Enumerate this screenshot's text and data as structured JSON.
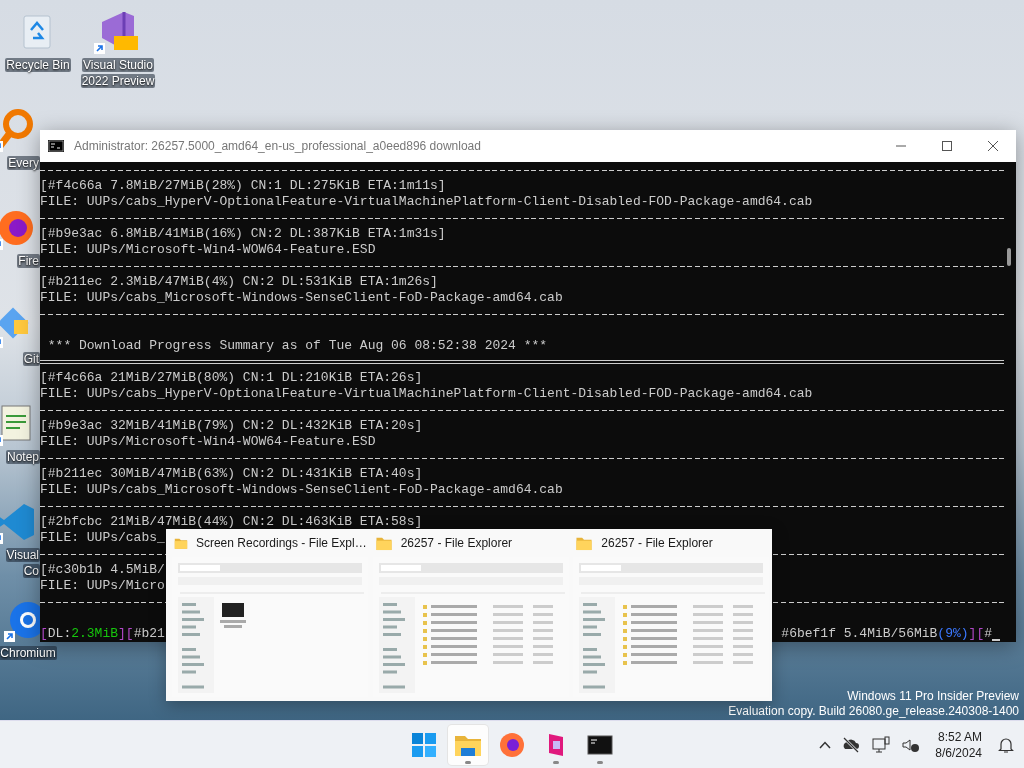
{
  "desktop_icons": [
    {
      "kind": "recycle",
      "shortcut": false,
      "label_lines": [
        "Recycle Bin"
      ]
    },
    {
      "kind": "vs",
      "shortcut": true,
      "label_lines": [
        "Visual Studio",
        "2022 Preview"
      ]
    },
    {
      "kind": "search",
      "shortcut": true,
      "label_lines": [
        "Every"
      ]
    },
    {
      "kind": "firefox",
      "shortcut": true,
      "label_lines": [
        "Fire"
      ]
    },
    {
      "kind": "git",
      "shortcut": true,
      "label_lines": [
        "Git"
      ]
    },
    {
      "kind": "notepad",
      "shortcut": true,
      "label_lines": [
        "Notep"
      ]
    },
    {
      "kind": "vscode",
      "shortcut": true,
      "label_lines": [
        "Visual",
        "Co"
      ]
    },
    {
      "kind": "chromium",
      "shortcut": true,
      "label_lines": [
        "Chromium"
      ]
    }
  ],
  "terminal": {
    "title": "Administrator:  26257.5000_amd64_en-us_professional_a0eed896 download",
    "lines": [
      {
        "kind": "rule"
      },
      {
        "kind": "text",
        "text": "[#f4c66a 7.8MiB/27MiB(28%) CN:1 DL:275KiB ETA:1m11s]"
      },
      {
        "kind": "text",
        "text": "FILE: UUPs/cabs_HyperV-OptionalFeature-VirtualMachinePlatform-Client-Disabled-FOD-Package-amd64.cab"
      },
      {
        "kind": "rule"
      },
      {
        "kind": "text",
        "text": "[#b9e3ac 6.8MiB/41MiB(16%) CN:2 DL:387KiB ETA:1m31s]"
      },
      {
        "kind": "text",
        "text": "FILE: UUPs/Microsoft-Win4-WOW64-Feature.ESD"
      },
      {
        "kind": "rule"
      },
      {
        "kind": "text",
        "text": "[#b211ec 2.3MiB/47MiB(4%) CN:2 DL:531KiB ETA:1m26s]"
      },
      {
        "kind": "text",
        "text": "FILE: UUPs/cabs_Microsoft-Windows-SenseClient-FoD-Package-amd64.cab"
      },
      {
        "kind": "rule"
      },
      {
        "kind": "blank"
      },
      {
        "kind": "text",
        "text": " *** Download Progress Summary as of Tue Aug 06 08:52:38 2024 ***"
      },
      {
        "kind": "double-rule"
      },
      {
        "kind": "text",
        "text": "[#f4c66a 21MiB/27MiB(80%) CN:1 DL:210KiB ETA:26s]"
      },
      {
        "kind": "text",
        "text": "FILE: UUPs/cabs_HyperV-OptionalFeature-VirtualMachinePlatform-Client-Disabled-FOD-Package-amd64.cab"
      },
      {
        "kind": "rule"
      },
      {
        "kind": "text",
        "text": "[#b9e3ac 32MiB/41MiB(79%) CN:2 DL:432KiB ETA:20s]"
      },
      {
        "kind": "text",
        "text": "FILE: UUPs/Microsoft-Win4-WOW64-Feature.ESD"
      },
      {
        "kind": "rule"
      },
      {
        "kind": "text",
        "text": "[#b211ec 30MiB/47MiB(63%) CN:2 DL:431KiB ETA:40s]"
      },
      {
        "kind": "text",
        "text": "FILE: UUPs/cabs_Microsoft-Windows-SenseClient-FoD-Package-amd64.cab"
      },
      {
        "kind": "rule"
      },
      {
        "kind": "text",
        "text": "[#2bfcbc 21MiB/47MiB(44%) CN:2 DL:463KiB ETA:58s]"
      },
      {
        "kind": "text",
        "text": "FILE: UUPs/cabs_"
      },
      {
        "kind": "rule"
      },
      {
        "kind": "text",
        "text": "[#c30b1b 4.5MiB/"
      },
      {
        "kind": "text",
        "text": "FILE: UUPs/Micro"
      },
      {
        "kind": "rule"
      },
      {
        "kind": "blank"
      },
      {
        "kind": "status",
        "left": [
          {
            "kind": "bracket",
            "text": "["
          },
          {
            "kind": "plain",
            "text": "DL:"
          },
          {
            "kind": "amount",
            "text": "2.3MiB"
          },
          {
            "kind": "bracket",
            "text": "]["
          },
          {
            "kind": "plain",
            "text": "#b21"
          }
        ],
        "right": [
          {
            "kind": "plain",
            "text": "#6bef1f 5.4MiB/56MiB"
          },
          {
            "kind": "percent",
            "text": "(9%)"
          },
          {
            "kind": "bracket",
            "text": "]["
          },
          {
            "kind": "plain",
            "text": "#"
          }
        ]
      }
    ]
  },
  "taskbar_preview": {
    "windows": [
      {
        "kind": "icons",
        "title": "Screen Recordings - File Expl…"
      },
      {
        "kind": "list",
        "title": "26257 - File Explorer"
      },
      {
        "kind": "list",
        "title": "26257 - File Explorer"
      }
    ]
  },
  "watermark": [
    "Windows 11 Pro Insider Preview",
    "Evaluation copy. Build 26080.ge_release.240308-1400"
  ],
  "taskbar": {
    "apps": [
      {
        "kind": "start",
        "running": false,
        "active": false
      },
      {
        "kind": "explorer",
        "running": true,
        "active": true
      },
      {
        "kind": "firefox",
        "running": false,
        "active": false
      },
      {
        "kind": "pinkapp",
        "running": true,
        "active": false
      },
      {
        "kind": "terminal",
        "running": true,
        "active": false
      }
    ],
    "time": "8:52 AM",
    "date": "8/6/2024"
  }
}
